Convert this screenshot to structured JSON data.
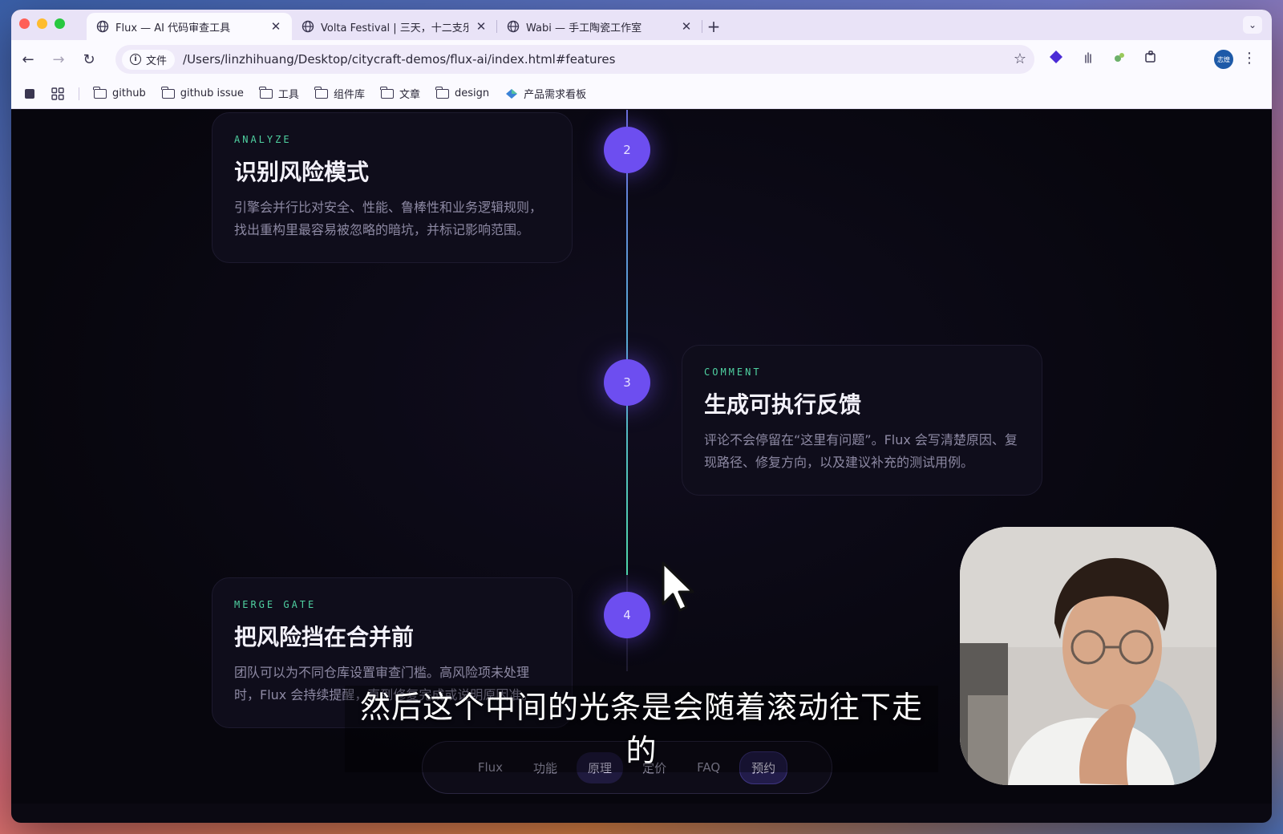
{
  "window": {
    "tabs": [
      {
        "title": "Flux — AI 代码审查工具",
        "active": true
      },
      {
        "title": "Volta Festival | 三天，十二支乐",
        "active": false
      },
      {
        "title": "Wabi — 手工陶瓷工作室",
        "active": false
      }
    ],
    "new_tab_label": "+"
  },
  "toolbar": {
    "security_chip": "文件",
    "url": "/Users/linzhihuang/Desktop/citycraft-demos/flux-ai/index.html#features",
    "avatar_text": "志煌"
  },
  "bookmarks": [
    {
      "label": "github",
      "type": "folder"
    },
    {
      "label": "github issue",
      "type": "folder"
    },
    {
      "label": "工具",
      "type": "folder"
    },
    {
      "label": "组件库",
      "type": "folder"
    },
    {
      "label": "文章",
      "type": "folder"
    },
    {
      "label": "design",
      "type": "folder"
    },
    {
      "label": "产品需求看板",
      "type": "link"
    }
  ],
  "timeline": {
    "steps": [
      {
        "number": "2",
        "tag": "ANALYZE",
        "title": "识别风险模式",
        "body": "引擎会并行比对安全、性能、鲁棒性和业务逻辑规则，找出重构里最容易被忽略的暗坑，并标记影响范围。"
      },
      {
        "number": "3",
        "tag": "COMMENT",
        "title": "生成可执行反馈",
        "body": "评论不会停留在“这里有问题”。Flux 会写清楚原因、复现路径、修复方向，以及建议补充的测试用例。"
      },
      {
        "number": "4",
        "tag": "MERGE GATE",
        "title": "把风险挡在合并前",
        "body": "团队可以为不同仓库设置审查门槛。高风险项未处理时，Flux 会持续提醒，直到修复完成或说明原因准。"
      }
    ],
    "colors": {
      "node": "#6d4ef0",
      "tag": "#4fd1a1",
      "line_top": "#6a6fd8",
      "line_bottom": "#4ed6a8"
    }
  },
  "bottom_nav": {
    "items": [
      "Flux",
      "功能",
      "原理",
      "定价",
      "FAQ"
    ],
    "active": "原理",
    "cta": "预约"
  },
  "caption": "然后这个中间的光条是会随着滚动往下走的"
}
